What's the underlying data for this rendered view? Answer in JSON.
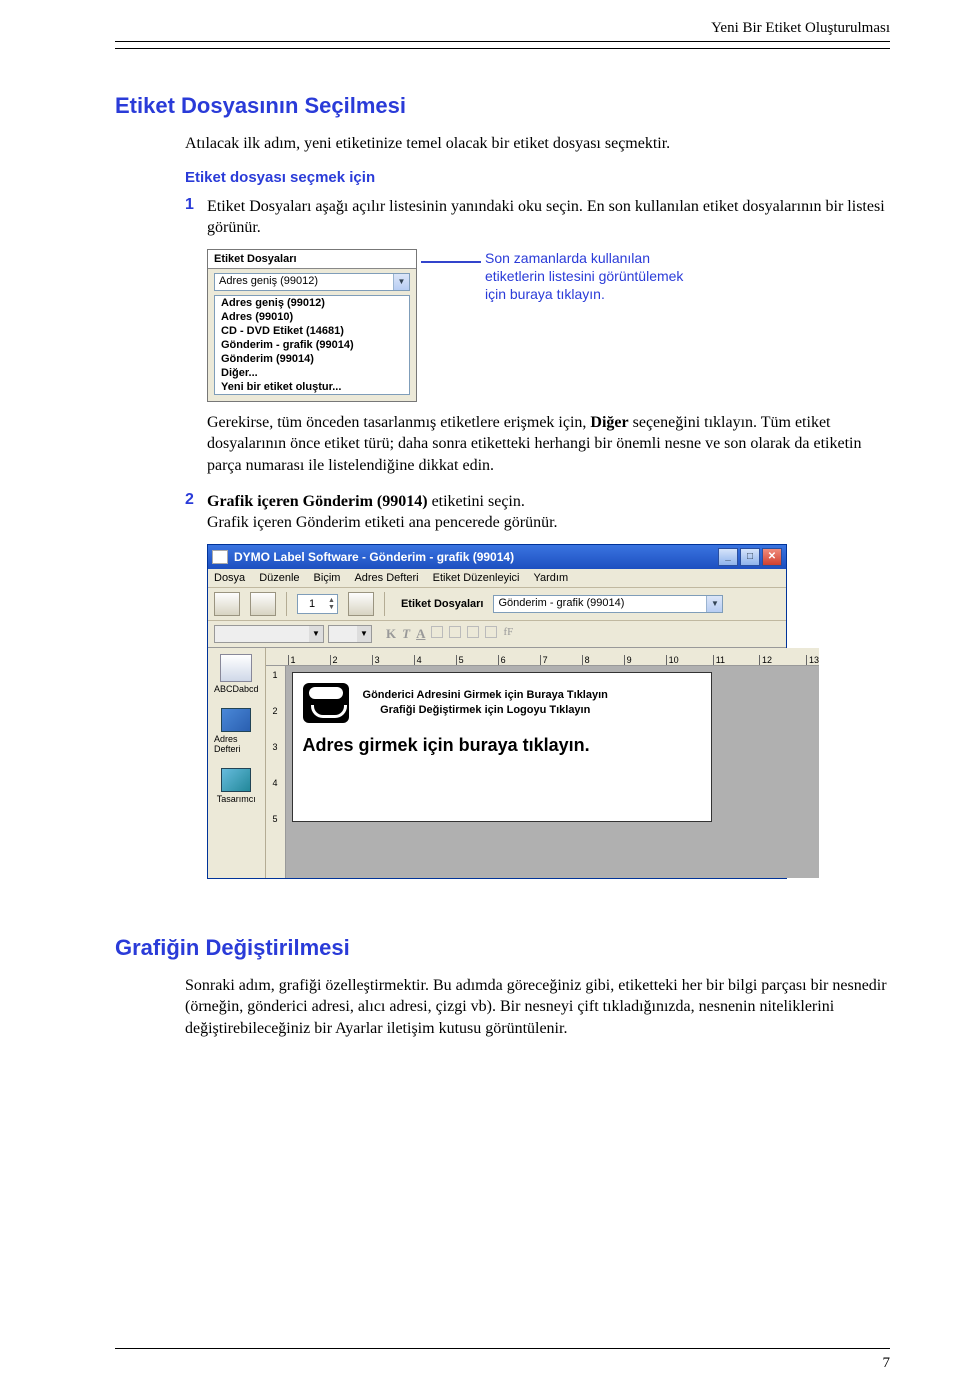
{
  "header": {
    "right_text": "Yeni Bir Etiket Oluşturulması"
  },
  "section1": {
    "title": "Etiket Dosyasının Seçilmesi",
    "p1": "Atılacak ilk adım, yeni etiketinize temel olacak bir etiket dosyası seçmektir.",
    "sub": "Etiket dosyası seçmek için",
    "step1_num": "1",
    "step1_text_a": "Etiket Dosyaları aşağı açılır listesinin yanındaki oku seçin. En son kullanılan etiket dosyalarının bir listesi görünür.",
    "dropdown": {
      "panel_title": "Etiket Dosyaları",
      "combo_value": "Adres geniş (99012)",
      "items": [
        "Adres geniş (99012)",
        "Adres (99010)",
        "CD - DVD Etiket (14681)",
        "Gönderim - grafik (99014)",
        "Gönderim (99014)",
        "Diğer...",
        "Yeni bir etiket oluştur..."
      ],
      "callout": "Son zamanlarda kullanılan etiketlerin listesini görüntülemek için buraya tıklayın."
    },
    "p2_a": "Gerekirse, tüm önceden tasarlanmış etiketlere erişmek için, ",
    "p2_b": "Diğer",
    "p2_c": " seçeneğini tıklayın. Tüm etiket dosyalarının önce etiket türü; daha sonra etiketteki herhangi bir önemli nesne ve son olarak da etiketin parça numarası ile listelendiğine dikkat edin.",
    "step2_num": "2",
    "step2_a": "Grafik içeren Gönderim (99014)",
    "step2_b": " etiketini seçin.",
    "step2_c": "Grafik içeren Gönderim etiketi ana pencerede görünür."
  },
  "app": {
    "title": "DYMO Label Software - Gönderim - grafik (99014)",
    "menus": [
      "Dosya",
      "Düzenle",
      "Biçim",
      "Adres Defteri",
      "Etiket Düzenleyici",
      "Yardım"
    ],
    "quantity": "1",
    "files_label": "Etiket Dosyaları",
    "files_value": "Gönderim - grafik (99014)",
    "format_ghost": [
      "K",
      "T",
      "A"
    ],
    "ruler_h": [
      "1",
      "2",
      "3",
      "4",
      "5",
      "6",
      "7",
      "8",
      "9",
      "10",
      "11",
      "12",
      "13"
    ],
    "ruler_v": [
      "1",
      "2",
      "3",
      "4",
      "5"
    ],
    "left_items": [
      {
        "label": "ABCDabcd"
      },
      {
        "label": "Adres Defteri"
      },
      {
        "label": "Tasarımcı"
      }
    ],
    "sender_line1": "Gönderici Adresini Girmek için Buraya Tıklayın",
    "sender_line2": "Grafiği Değiştirmek için Logoyu Tıklayın",
    "address_prompt": "Adres girmek için buraya tıklayın."
  },
  "section2": {
    "title": "Grafiğin Değiştirilmesi",
    "p": "Sonraki adım, grafiği özelleştirmektir. Bu adımda göreceğiniz gibi, etiketteki her bir bilgi parçası bir nesnedir (örneğin, gönderici adresi, alıcı adresi, çizgi vb). Bir nesneyi çift tıkladığınızda, nesnenin niteliklerini değiştirebileceğiniz bir Ayarlar iletişim kutusu görüntülenir."
  },
  "footer": {
    "page": "7"
  }
}
